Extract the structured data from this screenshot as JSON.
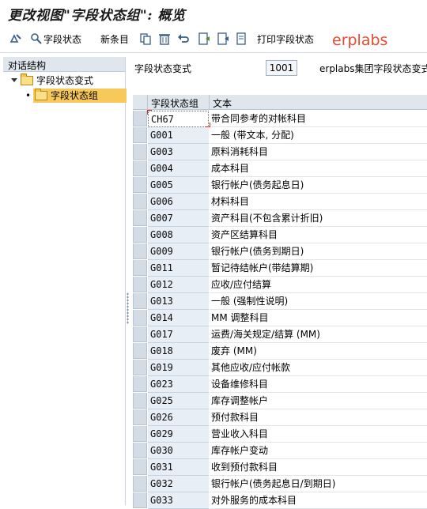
{
  "window": {
    "title": "更改视图\"字段状态组\": 概览"
  },
  "toolbar": {
    "field_status_label": "字段状态",
    "new_entries_label": "新条目",
    "print_label": "打印字段状态",
    "watermark": "erplabs"
  },
  "dialog_structure": {
    "header": "对话结构",
    "items": [
      {
        "label": "字段状态变式",
        "level": 0,
        "expanded": true,
        "selected": false
      },
      {
        "label": "字段状态组",
        "level": 1,
        "expanded": false,
        "selected": true
      }
    ]
  },
  "variant": {
    "label": "字段状态变式",
    "value": "1001",
    "description": "erplabs集团字段状态变式"
  },
  "table": {
    "columns": [
      "字段状态组",
      "文本"
    ],
    "rows": [
      {
        "code": "CH67",
        "text": "带合同参考的对帐科目"
      },
      {
        "code": "G001",
        "text": "一般 (带文本, 分配)"
      },
      {
        "code": "G003",
        "text": "原料消耗科目"
      },
      {
        "code": "G004",
        "text": "成本科目"
      },
      {
        "code": "G005",
        "text": "银行帐户(债务起息日)"
      },
      {
        "code": "G006",
        "text": "材料科目"
      },
      {
        "code": "G007",
        "text": "资产科目(不包含累计折旧)"
      },
      {
        "code": "G008",
        "text": "资产区结算科目"
      },
      {
        "code": "G009",
        "text": "银行帐户(债务到期日)"
      },
      {
        "code": "G011",
        "text": "暂记待结帐户(带结算期)"
      },
      {
        "code": "G012",
        "text": "应收/应付结算"
      },
      {
        "code": "G013",
        "text": "一般 (强制性说明)"
      },
      {
        "code": "G014",
        "text": "MM 调整科目"
      },
      {
        "code": "G017",
        "text": "运费/海关规定/结算 (MM)"
      },
      {
        "code": "G018",
        "text": "废弃 (MM)"
      },
      {
        "code": "G019",
        "text": "其他应收/应付帐款"
      },
      {
        "code": "G023",
        "text": "设备维修科目"
      },
      {
        "code": "G025",
        "text": "库存调整帐户"
      },
      {
        "code": "G026",
        "text": "预付款科目"
      },
      {
        "code": "G029",
        "text": "营业收入科目"
      },
      {
        "code": "G030",
        "text": "库存帐户变动"
      },
      {
        "code": "G031",
        "text": "收到预付款科目"
      },
      {
        "code": "G032",
        "text": "银行帐户(债务起息日/到期日)"
      },
      {
        "code": "G033",
        "text": "对外服务的成本科目"
      }
    ]
  }
}
